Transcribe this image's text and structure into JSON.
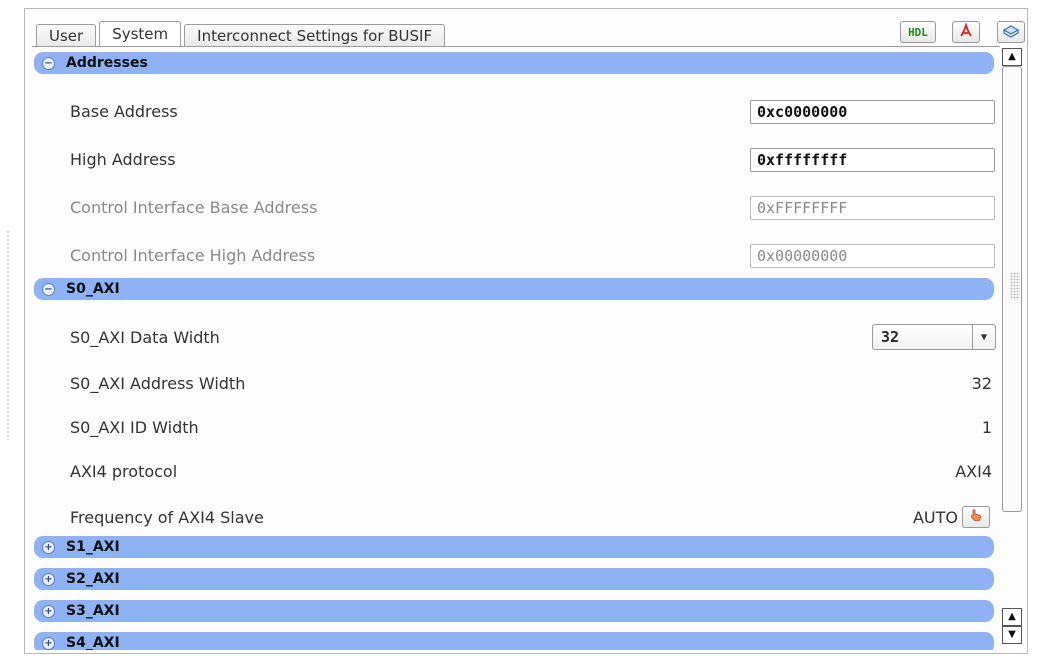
{
  "tabs": [
    {
      "label": "User",
      "active": false
    },
    {
      "label": "System",
      "active": true
    },
    {
      "label": "Interconnect Settings for BUSIF",
      "active": false
    }
  ],
  "toolbar": {
    "hdl_label": "HDL",
    "pdf_icon": "pdf-icon",
    "package_icon": "package-icon"
  },
  "sections": {
    "addresses": {
      "title": "Addresses",
      "expanded": true,
      "base_address": {
        "label": "Base Address",
        "value": "0xc0000000"
      },
      "high_address": {
        "label": "High Address",
        "value": "0xffffffff"
      },
      "ctrl_base": {
        "label": "Control Interface Base Address",
        "value": "0xFFFFFFFF"
      },
      "ctrl_high": {
        "label": "Control Interface High Address",
        "value": "0x00000000"
      }
    },
    "s0_axi": {
      "title": "S0_AXI",
      "expanded": true,
      "data_width": {
        "label": "S0_AXI Data Width",
        "value": "32"
      },
      "address_width": {
        "label": "S0_AXI Address Width",
        "value": "32"
      },
      "id_width": {
        "label": "S0_AXI ID Width",
        "value": "1"
      },
      "protocol": {
        "label": "AXI4 protocol",
        "value": "AXI4"
      },
      "frequency": {
        "label": "Frequency of AXI4 Slave",
        "value": "AUTO"
      }
    },
    "s1_axi": {
      "title": "S1_AXI",
      "expanded": false
    },
    "s2_axi": {
      "title": "S2_AXI",
      "expanded": false
    },
    "s3_axi": {
      "title": "S3_AXI",
      "expanded": false
    },
    "s4_axi": {
      "title": "S4_AXI",
      "expanded": false
    }
  },
  "colors": {
    "section_header": "#8fb2f5",
    "disabled_text": "#8a8a8a"
  }
}
